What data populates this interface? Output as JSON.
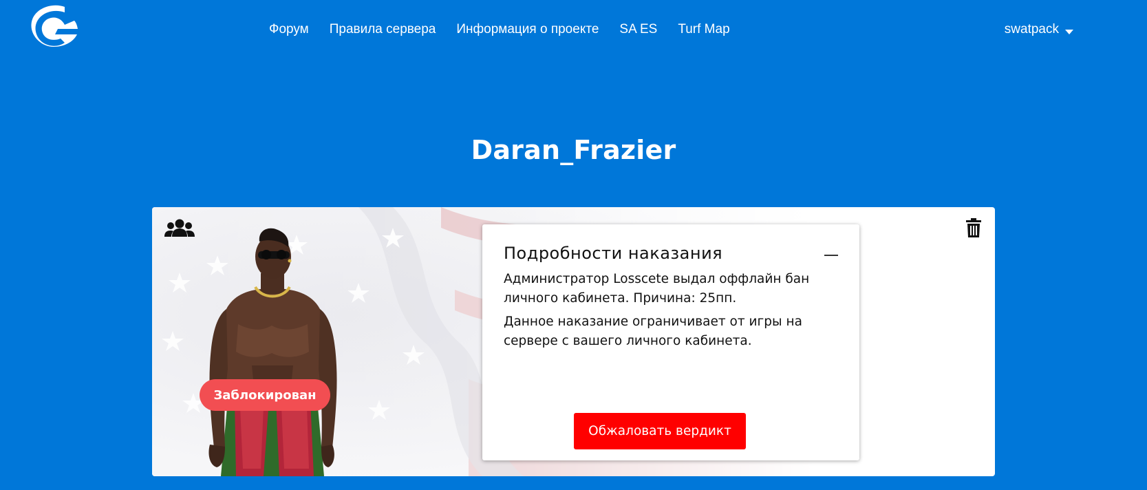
{
  "header": {
    "logo_icon": "gta-style-logo",
    "nav": [
      "Форум",
      "Правила сервера",
      "Информация о проекте",
      "SA ES",
      "Turf Map"
    ],
    "user": {
      "name": "swatpack",
      "dropdown_icon": "caret-down-icon"
    }
  },
  "profile": {
    "title": "Daran_Frazier",
    "status_badge": "Заблокирован",
    "icons": {
      "group": "group-icon",
      "delete": "trash-icon"
    }
  },
  "punishment": {
    "title": "Подробности наказания",
    "text_1": "Администратор Losscete выдал оффлайн бан личного кабинета. Причина: 25пп.",
    "text_2": "Данное наказание ограничивает от игры на сервере с вашего личного кабинета.",
    "appeal_label": "Обжаловать вердикт",
    "collapse_icon": "minus-icon"
  },
  "colors": {
    "background": "#0077d9",
    "badge": "#f24e52",
    "appeal_button": "#ff0000"
  }
}
